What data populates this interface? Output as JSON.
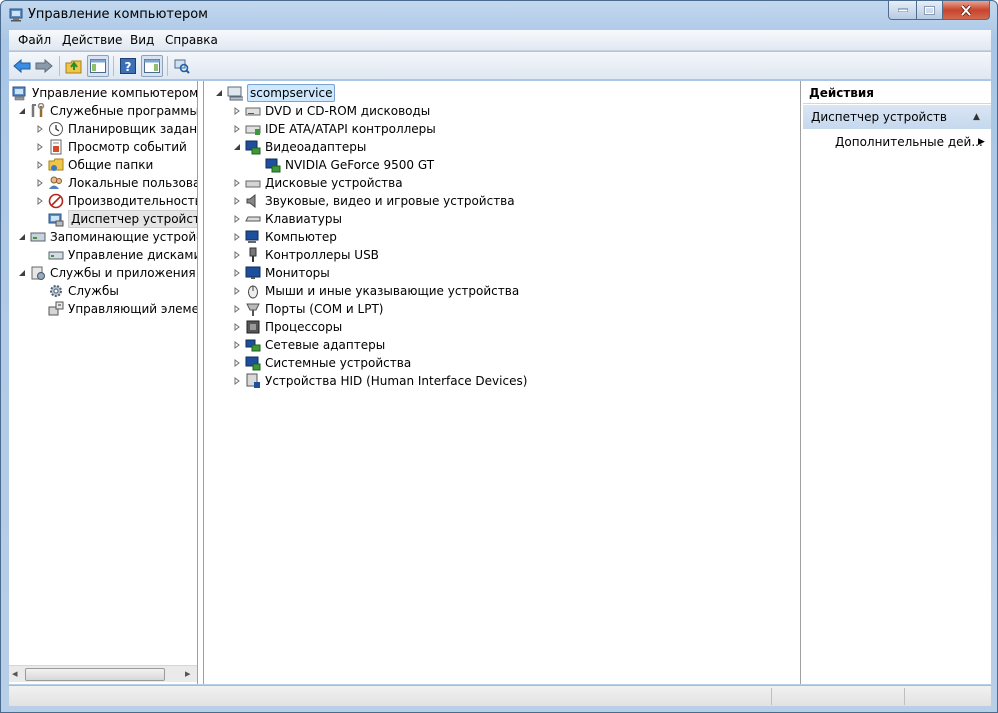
{
  "window": {
    "title": "Управление компьютером",
    "controls": {
      "minimize": "—",
      "maximize": "□",
      "close": "✕"
    }
  },
  "menu": [
    "Файл",
    "Действие",
    "Вид",
    "Справка"
  ],
  "toolbar": {
    "icons": [
      "back-arrow-icon",
      "forward-arrow-icon",
      "folder-up-icon",
      "show-hide-tree-icon",
      "help-icon",
      "show-hide-action-pane-icon",
      "device-scan-icon"
    ]
  },
  "tree": {
    "root": "Управление компьютером (л",
    "groups": [
      {
        "label": "Служебные программы",
        "items": [
          "Планировщик заданий",
          "Просмотр событий",
          "Общие папки",
          "Локальные пользовате",
          "Производительность",
          "Диспетчер устройств"
        ]
      },
      {
        "label": "Запоминающие устройст",
        "items": [
          "Управление дисками"
        ]
      },
      {
        "label": "Службы и приложения",
        "items": [
          "Службы",
          "Управляющий элемен"
        ]
      }
    ]
  },
  "devices": {
    "host": "scompservice",
    "categories": [
      "DVD и CD-ROM дисководы",
      "IDE ATA/ATAPI контроллеры",
      "Видеоадаптеры",
      "Дисковые устройства",
      "Звуковые, видео и игровые устройства",
      "Клавиатуры",
      "Компьютер",
      "Контроллеры USB",
      "Мониторы",
      "Мыши и иные указывающие устройства",
      "Порты (COM и LPT)",
      "Процессоры",
      "Сетевые адаптеры",
      "Системные устройства",
      "Устройства HID (Human Interface Devices)"
    ],
    "video_child": "NVIDIA GeForce 9500 GT"
  },
  "actions": {
    "header": "Действия",
    "section": "Диспетчер устройств",
    "more": "Дополнительные дей..."
  },
  "glyphs": {
    "expanded": "◢",
    "collapsed": "▷",
    "arrow_up": "▲",
    "arrow_right": "▶",
    "scroll_left": "◂",
    "scroll_right": "▸"
  }
}
